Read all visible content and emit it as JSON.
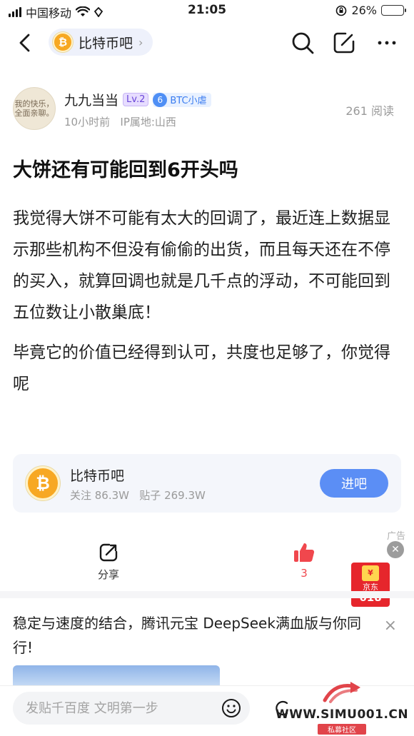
{
  "status_bar": {
    "carrier": "中国移动",
    "time": "21:05",
    "battery_percent": "26%",
    "battery_level": 0.26
  },
  "nav": {
    "forum_name": "比特币吧",
    "forum_icon_glyph": "₿",
    "chevron": "›",
    "icons": [
      "back-icon",
      "search-icon",
      "edit-icon",
      "more-icon"
    ]
  },
  "author": {
    "avatar_text": "我的快乐，\n全面亲聊。",
    "name": "九九当当",
    "level": "Lv.2",
    "title_badge_num": "6",
    "title_badge_text": "BTC小虐",
    "meta": "10小时前   IP属地:山西",
    "read_count": "261 阅读"
  },
  "post": {
    "title": "大饼还有可能回到6开头吗",
    "paragraph_1": "我觉得大饼不可能有太大的回调了，最近连上数据显示那些机构不但没有偷偷的出货，而且每天还在不停的买入，就算回调也就是几千点的浮动，不可能回到五位数让小散巢底！",
    "paragraph_2": "毕竟它的价值已经得到认可，共度也足够了，你觉得呢"
  },
  "forum_card": {
    "name": "比特币吧",
    "icon_glyph": "₿",
    "stats": "关注 86.3W   贴子 269.3W",
    "enter_label": "进吧"
  },
  "actions": {
    "share_label": "分享",
    "like_count": "3",
    "ad_tag": "广告",
    "close_glyph": "✕"
  },
  "jd_promo": {
    "hongbao": "¥",
    "brand": "京东",
    "event": "618"
  },
  "ad": {
    "text": "稳定与速度的结合，腾讯元宝 DeepSeek满血版与你同行!",
    "close_glyph": "×"
  },
  "bottom_bar": {
    "reply_placeholder": "发贴千百度 文明第一步"
  },
  "watermark": {
    "url": "WWW.SIMU001.CN",
    "sub": "私募社区"
  },
  "colors": {
    "accent_blue": "#5b8ef5",
    "like_red": "#f0474d",
    "coin_orange": "#f7a823",
    "level_purple": "#6a46d8"
  }
}
